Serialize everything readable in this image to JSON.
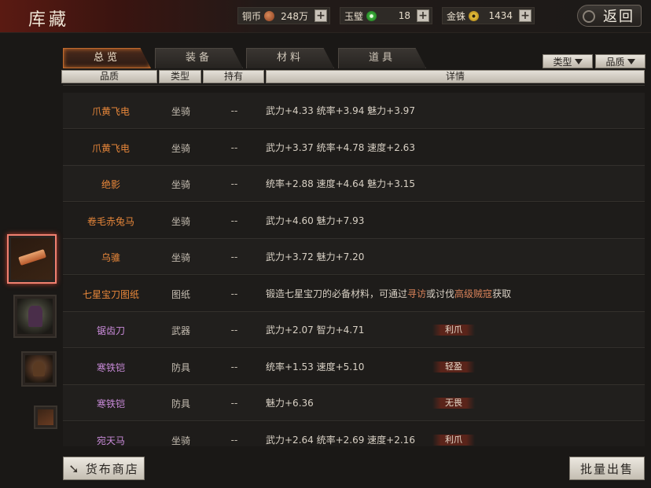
{
  "header": {
    "title": "库藏",
    "back_label": "返回"
  },
  "currencies": [
    {
      "label": "铜币",
      "icon": "copper-coin-icon",
      "value": "248万"
    },
    {
      "label": "玉璧",
      "icon": "jade-disc-icon",
      "value": "18"
    },
    {
      "label": "金铢",
      "icon": "gold-coin-icon",
      "value": "1434"
    }
  ],
  "tabs": [
    {
      "label": "总览",
      "active": true
    },
    {
      "label": "装备",
      "active": false
    },
    {
      "label": "材料",
      "active": false
    },
    {
      "label": "道具",
      "active": false
    }
  ],
  "filters": {
    "type_label": "类型",
    "quality_label": "品质"
  },
  "columns": {
    "quality": "品质",
    "type": "类型",
    "owned": "持有",
    "detail": "详情"
  },
  "rows": [
    {
      "name": "爪黄飞电",
      "quality": "orange",
      "type": "坐骑",
      "owned": "--",
      "detail": "武力+4.33  统率+3.94  魅力+3.97",
      "tag": ""
    },
    {
      "name": "爪黄飞电",
      "quality": "orange",
      "type": "坐骑",
      "owned": "--",
      "detail": "武力+3.37  统率+4.78  速度+2.63",
      "tag": ""
    },
    {
      "name": "绝影",
      "quality": "orange",
      "type": "坐骑",
      "owned": "--",
      "detail": "统率+2.88  速度+4.64  魅力+3.15",
      "tag": ""
    },
    {
      "name": "卷毛赤兔马",
      "quality": "orange",
      "type": "坐骑",
      "owned": "--",
      "detail": "武力+4.60  魅力+7.93",
      "tag": ""
    },
    {
      "name": "乌骓",
      "quality": "orange",
      "type": "坐骑",
      "owned": "--",
      "detail": "武力+3.72  魅力+7.20",
      "tag": ""
    },
    {
      "name": "七星宝刀图纸",
      "quality": "orange",
      "type": "图纸",
      "owned": "--",
      "detail_parts": [
        "锻造七星宝刀的必备材料，可通过",
        "寻访",
        "或讨伐",
        "高级贼寇",
        "获取"
      ],
      "tag": ""
    },
    {
      "name": "锯齿刀",
      "quality": "purple",
      "type": "武器",
      "owned": "--",
      "detail": "武力+2.07  智力+4.71",
      "tag": "利爪"
    },
    {
      "name": "寒铁铠",
      "quality": "purple",
      "type": "防具",
      "owned": "--",
      "detail": "统率+1.53  速度+5.10",
      "tag": "轻盈"
    },
    {
      "name": "寒铁铠",
      "quality": "purple",
      "type": "防具",
      "owned": "--",
      "detail": "魅力+6.36",
      "tag": "无畏"
    },
    {
      "name": "宛天马",
      "quality": "purple",
      "type": "坐骑",
      "owned": "--",
      "detail": "武力+2.64  统率+2.69  速度+2.16",
      "tag": "利爪"
    }
  ],
  "thumbnails": [
    {
      "name": "scroll-item-icon",
      "selected": true
    },
    {
      "name": "purple-armor-icon",
      "selected": false
    },
    {
      "name": "bronze-armor-icon",
      "selected": false
    },
    {
      "name": "small-scroll-icon",
      "selected": false
    }
  ],
  "bottom": {
    "shop_label": "货布商店",
    "sell_label": "批量出售"
  },
  "colors": {
    "quality_orange": "#e8873a",
    "quality_purple": "#c88ad8",
    "active_tab_border": "#c06a2e",
    "selected_thumb_border": "#f08070"
  }
}
